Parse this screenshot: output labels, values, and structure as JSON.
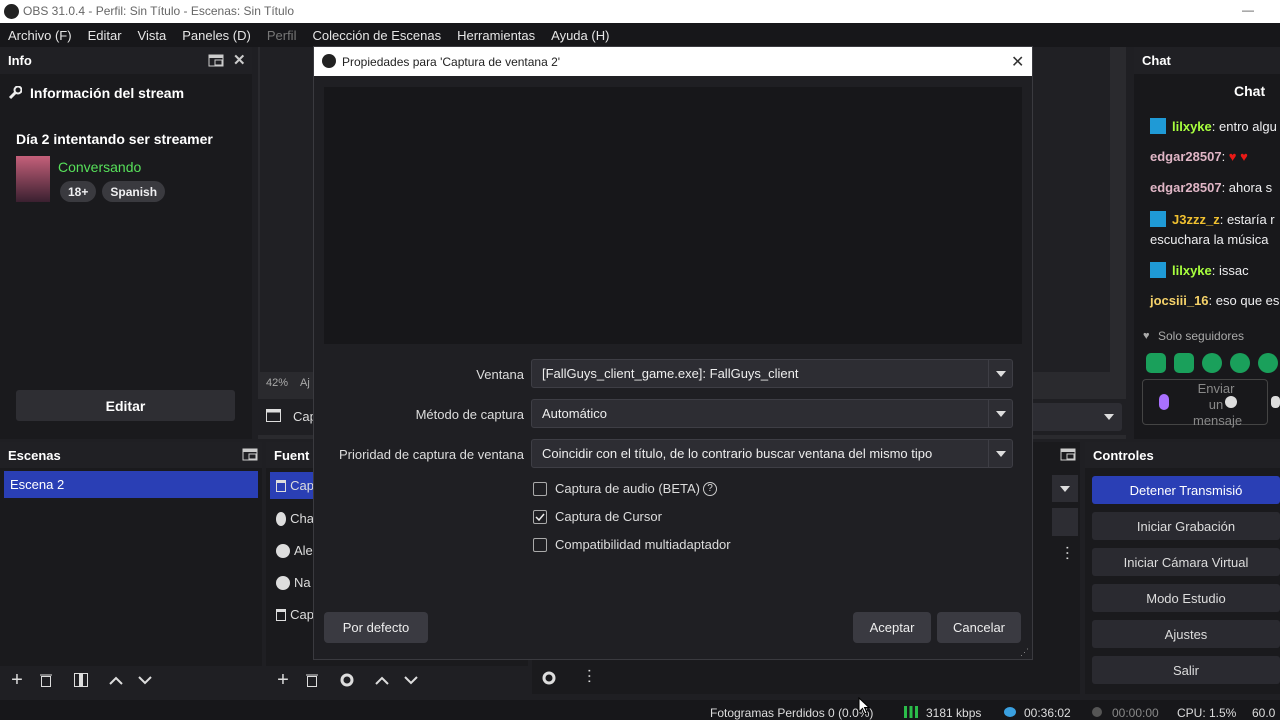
{
  "titlebar": {
    "title": "OBS 31.0.4 - Perfil: Sin Título - Escenas: Sin Título",
    "min": "—"
  },
  "menu": {
    "archivo": "Archivo (F)",
    "editar": "Editar",
    "vista": "Vista",
    "paneles": "Paneles (D)",
    "perfil": "Perfil",
    "coleccion": "Colección de Escenas",
    "herramientas": "Herramientas",
    "ayuda": "Ayuda (H)"
  },
  "info": {
    "header": "Info",
    "section_title": "Información del stream",
    "stream_title": "Día 2 intentando ser streamer",
    "category": "Conversando",
    "tags": [
      "18+",
      "Spanish"
    ],
    "edit_label": "Editar"
  },
  "preview": {
    "zoom": "42%",
    "zoom_suffix": "Aj",
    "source_label": "Cap"
  },
  "chat": {
    "header": "Chat",
    "title": "Chat",
    "messages": [
      {
        "user": "lilxyke",
        "text": "entro algu",
        "color": "#a8ff3e",
        "badge": true
      },
      {
        "user": "edgar28507",
        "text": "♥ ♥",
        "color": "#e0b6c6",
        "badge": false
      },
      {
        "user": "edgar28507",
        "text": "ahora s",
        "color": "#e0b6c6",
        "badge": false
      },
      {
        "user": "J3zzz_z",
        "text": "estaría r",
        "color": "#f0c030",
        "badge": true
      },
      {
        "user": "",
        "text": "escuchara la música",
        "color": "#efeff1",
        "badge": false
      },
      {
        "user": "lilxyke",
        "text": "issac",
        "color": "#a8ff3e",
        "badge": true
      },
      {
        "user": "jocsiii_16",
        "text": "eso que es",
        "color": "#f5d26a",
        "badge": false
      }
    ],
    "followers_only": "Solo seguidores",
    "placeholder": "Enviar un mensaje",
    "accent": "#1aa05b"
  },
  "scenes": {
    "header": "Escenas",
    "items": [
      "Escena 2"
    ]
  },
  "sources": {
    "header": "Fuent",
    "items": [
      "Cap",
      "Cha",
      "Ale",
      "Na",
      "Cap"
    ]
  },
  "controls": {
    "header": "Controles",
    "buttons": [
      "Detener Transmisió",
      "Iniciar Grabación",
      "Iniciar Cámara Virtual",
      "Modo Estudio",
      "Ajustes",
      "Salir"
    ],
    "accent": "#2a3fb5"
  },
  "dialog": {
    "title": "Propiedades para 'Captura de ventana 2'",
    "ventana_label": "Ventana",
    "ventana_value": "[FallGuys_client_game.exe]: FallGuys_client",
    "metodo_label": "Método de captura",
    "metodo_value": "Automático",
    "prioridad_label": "Prioridad de captura de ventana",
    "prioridad_value": "Coincidir con el título, de lo contrario buscar ventana del mismo tipo",
    "checkboxes": [
      {
        "label": "Captura de audio (BETA)",
        "checked": false
      },
      {
        "label": "Captura de Cursor",
        "checked": true
      },
      {
        "label": "Compatibilidad multiadaptador",
        "checked": false
      }
    ],
    "default_btn": "Por defecto",
    "accept_btn": "Aceptar",
    "cancel_btn": "Cancelar"
  },
  "status": {
    "dropped": "Fotogramas Perdidos 0 (0.0%)",
    "kbps": "3181 kbps",
    "live_time": "00:36:02",
    "rec_time": "00:00:00",
    "cpu": "CPU: 1.5%",
    "fps": "60.0"
  }
}
